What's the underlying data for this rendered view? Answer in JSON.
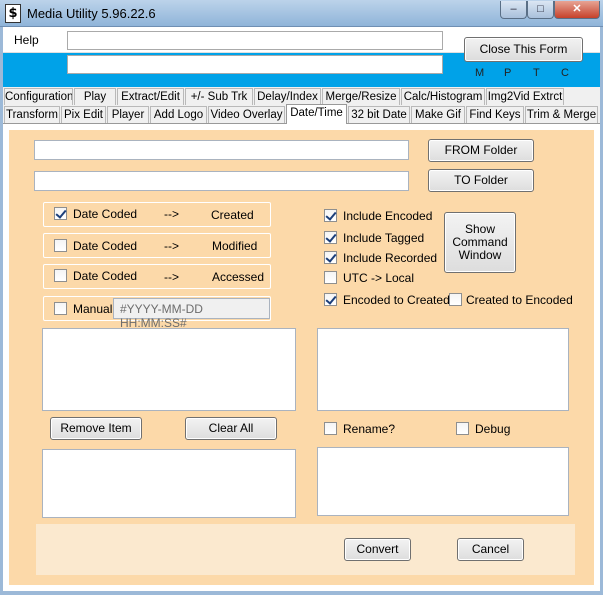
{
  "window": {
    "icon_glyph": "$",
    "title": "Media Utility 5.96.22.6",
    "min_glyph": "–",
    "max_glyph": "□",
    "close_glyph": "✕"
  },
  "header": {
    "menu_help": "Help",
    "close_form_label": "Close This Form",
    "mptc": [
      "M",
      "P",
      "T",
      "C"
    ],
    "status_line1": "",
    "status_line2": ""
  },
  "tabs": {
    "row1": [
      "Configuration",
      "Play",
      "Extract/Edit",
      "+/- Sub Trk",
      "Delay/Index",
      "Merge/Resize",
      "Calc/Histogram",
      "Img2Vid Extrct"
    ],
    "row2": [
      "Transform",
      "Pix Edit",
      "Player",
      "Add Logo",
      "Video Overlay",
      "Date/Time",
      "32 bit Date",
      "Make Gif",
      "Find Keys",
      "Trim & Merge"
    ],
    "active": "Date/Time"
  },
  "datetime": {
    "from_path": "",
    "to_path": "",
    "from_button": "FROM Folder",
    "to_button": "TO Folder",
    "mappings": [
      {
        "source": "Date Coded",
        "arrow": "-->",
        "target": "Created",
        "checked": true
      },
      {
        "source": "Date Coded",
        "arrow": "-->",
        "target": "Modified",
        "checked": false
      },
      {
        "source": "Date Coded",
        "arrow": "-->",
        "target": "Accessed",
        "checked": false
      }
    ],
    "manual": {
      "label": "Manual",
      "checked": false,
      "placeholder": "#YYYY-MM-DD HH:MM:SS#"
    },
    "options": [
      {
        "label": "Include Encoded",
        "checked": true
      },
      {
        "label": "Include Tagged",
        "checked": true
      },
      {
        "label": "Include Recorded",
        "checked": true
      },
      {
        "label": "UTC -> Local",
        "checked": false
      },
      {
        "label": "Encoded to Created",
        "checked": true
      }
    ],
    "created_to_encoded": {
      "label": "Created to Encoded",
      "checked": false
    },
    "show_command_window": "Show Command Window",
    "show_cmd_lines": [
      "Show",
      "Command",
      "Window"
    ],
    "remove_item": "Remove Item",
    "clear_all": "Clear All",
    "rename": {
      "label": "Rename?",
      "checked": false
    },
    "debug": {
      "label": "Debug",
      "checked": false
    },
    "convert": "Convert",
    "cancel": "Cancel"
  },
  "colors": {
    "panel_bg": "#fcd9a9",
    "header_accent": "#00a2e8",
    "bottom_strip": "#fbe9cf"
  }
}
